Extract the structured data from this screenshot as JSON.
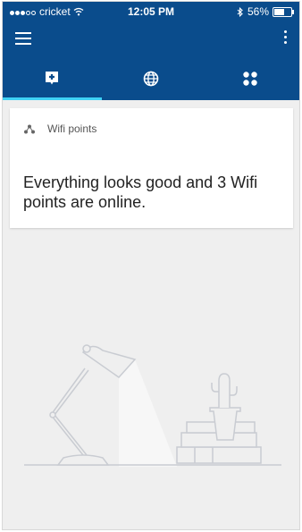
{
  "status_bar": {
    "carrier": "cricket",
    "time": "12:05 PM",
    "battery_percent": "56%",
    "battery_level": 0.56
  },
  "tabs": [
    {
      "icon": "status-icon",
      "active": true
    },
    {
      "icon": "globe-icon",
      "active": false
    },
    {
      "icon": "devices-icon",
      "active": false
    }
  ],
  "card": {
    "header_label": "Wifi points",
    "message": "Everything looks good and 3 Wifi points are online."
  },
  "colors": {
    "app_bar": "#0a4c8c",
    "tab_indicator": "#3fd2f5",
    "background": "#efefef"
  }
}
